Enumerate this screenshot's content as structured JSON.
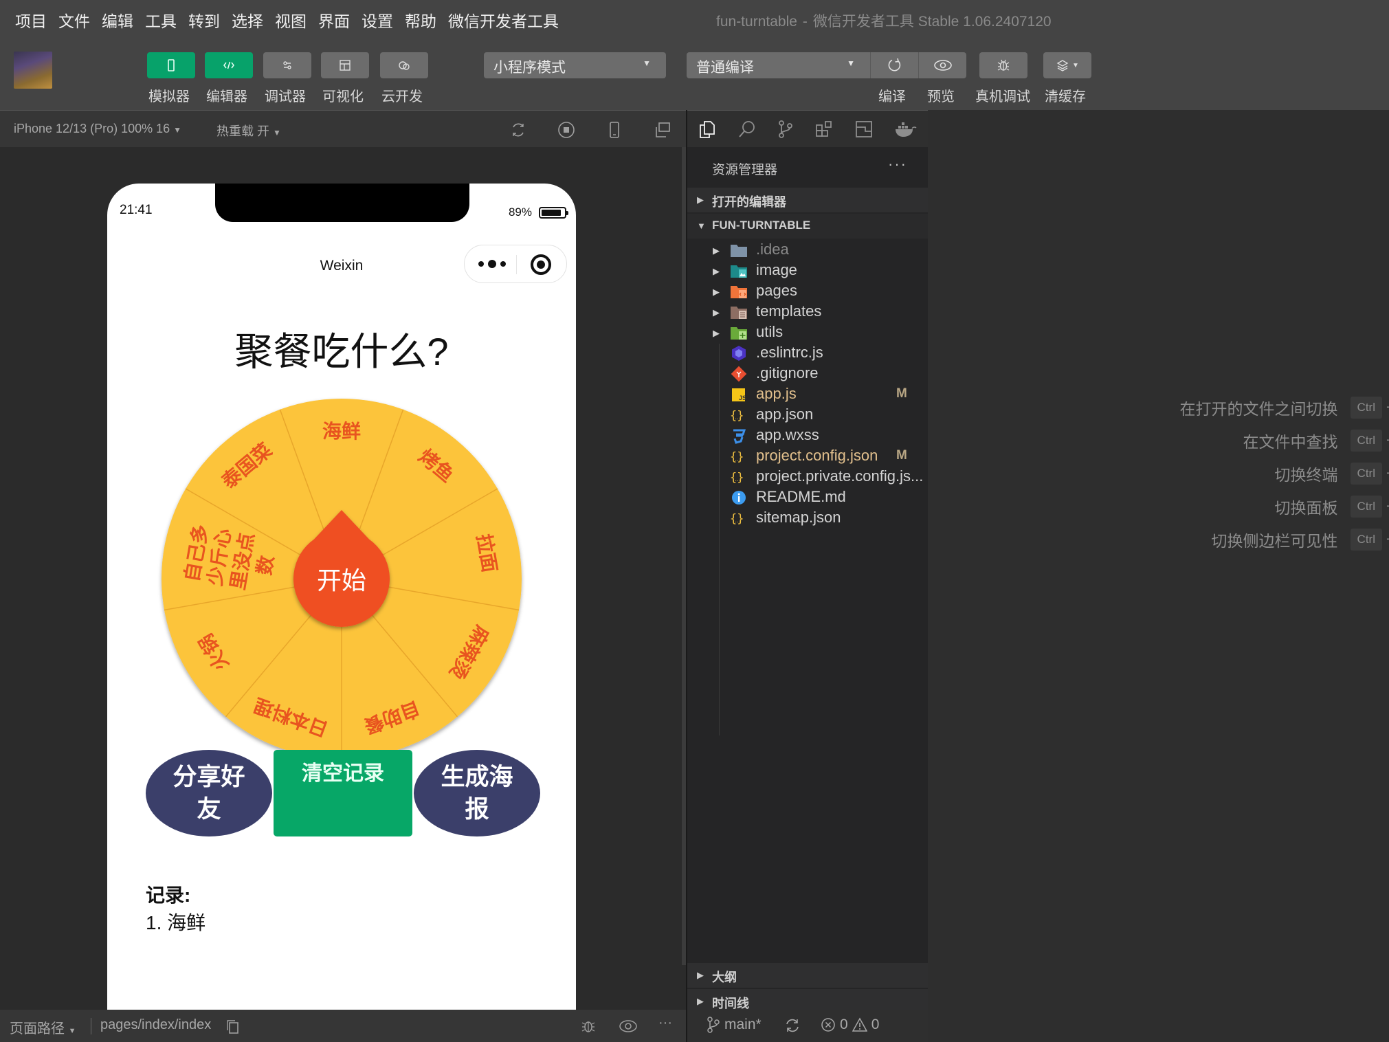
{
  "menu": {
    "items": [
      "项目",
      "文件",
      "编辑",
      "工具",
      "转到",
      "选择",
      "视图",
      "界面",
      "设置",
      "帮助",
      "微信开发者工具"
    ],
    "window_title_project": "fun-turntable",
    "window_title_sep": "-",
    "window_title_app": "微信开发者工具 Stable 1.06.2407120"
  },
  "toolbar": {
    "view_buttons": [
      {
        "label": "模拟器",
        "icon": "phone-icon",
        "active": true
      },
      {
        "label": "编辑器",
        "icon": "code-icon",
        "active": true
      },
      {
        "label": "调试器",
        "icon": "sliders-icon",
        "active": false
      },
      {
        "label": "可视化",
        "icon": "layout-icon",
        "active": false
      },
      {
        "label": "云开发",
        "icon": "cloud-icon",
        "active": false
      }
    ],
    "mode_select": "小程序模式",
    "compile_select": "普通编译",
    "compile_label": "编译",
    "preview_label": "预览",
    "remote_debug_label": "真机调试",
    "clear_cache_label": "清缓存"
  },
  "simulator": {
    "device": "iPhone 12/13 (Pro) 100% 16",
    "hot_reload": "热重载 开",
    "status_time": "21:41",
    "battery": "89%",
    "battery_level": 0.89,
    "nav_title": "Weixin",
    "page_title": "聚餐吃什么?",
    "wheel": {
      "segments": [
        "海鲜",
        "烤鱼",
        "拉面",
        "麻辣烫",
        "自助餐",
        "日本料理",
        "火锅",
        "自己多少斤心里没点数",
        "泰国菜"
      ],
      "center_button": "开始",
      "colors": {
        "fill": "#fcc43a",
        "divider": "#e8a62a",
        "text": "#e8541f",
        "pointer": "#ef5021"
      }
    },
    "buttons": {
      "share": "分享好友",
      "clear": "清空记录",
      "poster": "生成海报"
    },
    "records_heading": "记录:",
    "records": [
      "1. 海鲜"
    ],
    "footer_path_label": "页面路径",
    "footer_path": "pages/index/index"
  },
  "explorer": {
    "title": "资源管理器",
    "more": "···",
    "open_editors": "打开的编辑器",
    "project": "FUN-TURNTABLE",
    "files": [
      {
        "name": ".idea",
        "type": "folder",
        "icon": "folder-idea-icon",
        "dim": true
      },
      {
        "name": "image",
        "type": "folder",
        "icon": "folder-image-icon"
      },
      {
        "name": "pages",
        "type": "folder",
        "icon": "folder-pages-icon"
      },
      {
        "name": "templates",
        "type": "folder",
        "icon": "folder-templates-icon"
      },
      {
        "name": "utils",
        "type": "folder",
        "icon": "folder-utils-icon"
      },
      {
        "name": ".eslintrc.js",
        "type": "file",
        "icon": "eslint-icon"
      },
      {
        "name": ".gitignore",
        "type": "file",
        "icon": "git-icon"
      },
      {
        "name": "app.js",
        "type": "file",
        "icon": "js-icon",
        "badge": "M"
      },
      {
        "name": "app.json",
        "type": "file",
        "icon": "json-icon"
      },
      {
        "name": "app.wxss",
        "type": "file",
        "icon": "css-icon"
      },
      {
        "name": "project.config.json",
        "type": "file",
        "icon": "json-icon",
        "badge": "M"
      },
      {
        "name": "project.private.config.js...",
        "type": "file",
        "icon": "json-icon"
      },
      {
        "name": "README.md",
        "type": "file",
        "icon": "info-icon"
      },
      {
        "name": "sitemap.json",
        "type": "file",
        "icon": "json-icon"
      }
    ],
    "outline": "大纲",
    "timeline": "时间线",
    "branch": "main*",
    "errors": "0",
    "warnings": "0"
  },
  "editor": {
    "shortcuts": [
      {
        "label": "在打开的文件之间切换",
        "key": "Ctrl"
      },
      {
        "label": "在文件中查找",
        "key": "Ctrl"
      },
      {
        "label": "切换终端",
        "key": "Ctrl"
      },
      {
        "label": "切换面板",
        "key": "Ctrl"
      },
      {
        "label": "切换侧边栏可见性",
        "key": "Ctrl"
      }
    ]
  }
}
